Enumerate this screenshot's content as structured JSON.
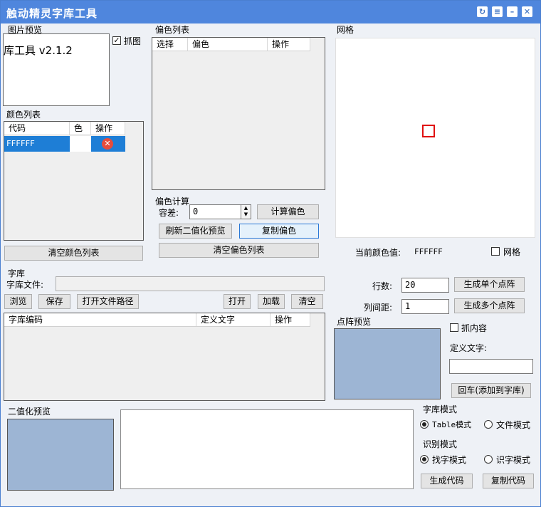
{
  "window": {
    "title": "触动精灵字库工具"
  },
  "titlebar_icons": [
    "refresh-icon",
    "menu-icon",
    "minimize-icon",
    "close-icon"
  ],
  "preview": {
    "group": "图片预览",
    "text": "库工具 v2.1.2",
    "capture_label": "抓图",
    "capture_checked": true
  },
  "color_list": {
    "group": "颜色列表",
    "columns": [
      "代码",
      "色",
      "操作"
    ],
    "rows": [
      {
        "code": "FFFFFF",
        "color": "#FFFFFF",
        "action_icon": "delete-icon"
      }
    ],
    "clear_button": "清空颜色列表"
  },
  "offset_list": {
    "group": "偏色列表",
    "columns": [
      "选择",
      "偏色",
      "操作"
    ]
  },
  "offset_calc": {
    "group": "偏色计算",
    "tolerance_label": "容差:",
    "tolerance_value": "0",
    "calc_button": "计算偏色",
    "refresh_button": "刷新二值化预览",
    "copy_button": "复制偏色",
    "clear_button": "清空偏色列表"
  },
  "grid": {
    "group": "网格",
    "current_color_label": "当前颜色值:",
    "current_color_value": "FFFFFF",
    "grid_checkbox_label": "网格",
    "grid_checked": false
  },
  "font_lib": {
    "group": "字库",
    "file_label": "字库文件:",
    "file_value": "",
    "buttons": {
      "browse": "浏览",
      "save": "保存",
      "open_path": "打开文件路径",
      "open": "打开",
      "load": "加载",
      "clear": "清空"
    },
    "columns": [
      "字库编码",
      "定义文字",
      "操作"
    ],
    "rows_label": "行数:",
    "rows_value": "20",
    "col_spacing_label": "列间距:",
    "col_spacing_value": "1",
    "gen_single": "生成单个点阵",
    "gen_multi": "生成多个点阵",
    "dot_preview": "点阵预览",
    "grab_content": "抓内容",
    "grab_checked": false,
    "define_text_label": "定义文字:",
    "define_text_value": "",
    "enter_add": "回车(添加到字库)"
  },
  "binary_preview": {
    "group": "二值化预览"
  },
  "lib_mode": {
    "group": "字库模式",
    "options": [
      "Table模式",
      "文件模式"
    ],
    "selected": 0
  },
  "recog_mode": {
    "group": "识别模式",
    "options": [
      "找字模式",
      "识字模式"
    ],
    "selected": 0
  },
  "code_buttons": {
    "generate": "生成代码",
    "copy": "复制代码"
  },
  "colors": {
    "titlebar": "#4f86dd",
    "selected_row": "#1e7ed6",
    "grid_marker": "#e01010",
    "preview_fill": "#9db5d4"
  }
}
